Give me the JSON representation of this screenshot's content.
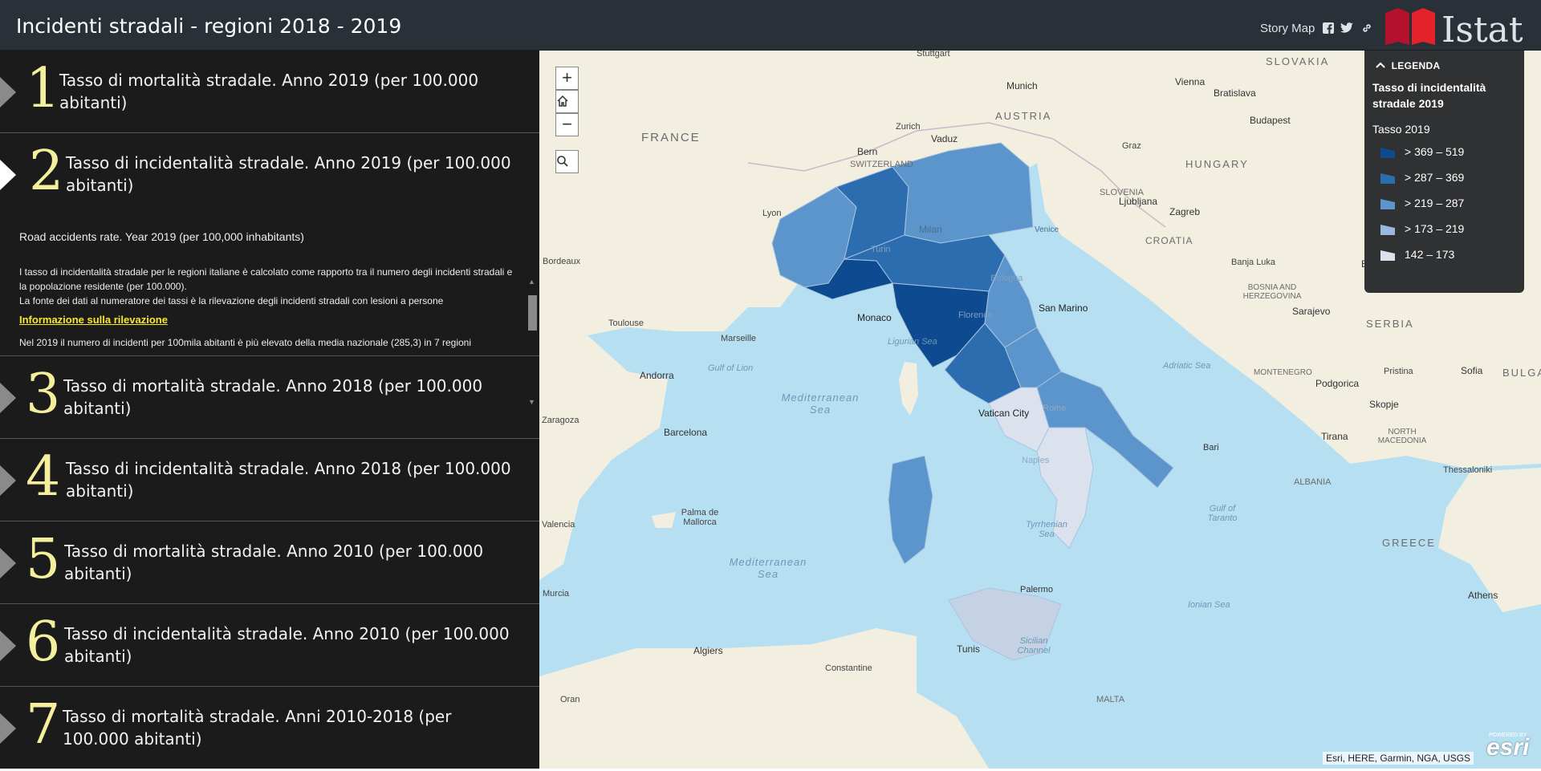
{
  "header": {
    "title": "Incidenti stradali - regioni 2018 - 2019",
    "story_map": "Story Map",
    "icons": [
      "facebook-icon",
      "twitter-icon",
      "link-icon"
    ],
    "logo_text": "Istat"
  },
  "sections": [
    {
      "num": "1",
      "title": "Tasso di mortalità stradale. Anno 2019 (per 100.000 abitanti)"
    },
    {
      "num": "2",
      "title": "Tasso di incidentalità stradale. Anno 2019 (per 100.000 abitanti)"
    },
    {
      "num": "3",
      "title": "Tasso di mortalità stradale. Anno 2018 (per 100.000 abitanti)"
    },
    {
      "num": "4",
      "title": "Tasso di incidentalità stradale. Anno 2018 (per 100.000 abitanti)"
    },
    {
      "num": "5",
      "title": "Tasso di mortalità stradale. Anno 2010 (per 100.000 abitanti)"
    },
    {
      "num": "6",
      "title": "Tasso di incidentalità stradale. Anno 2010 (per 100.000 abitanti)"
    },
    {
      "num": "7",
      "title": "Tasso di mortalità stradale. Anni 2010-2018 (per 100.000 abitanti)"
    }
  ],
  "active_section": {
    "english": "Road accidents rate. Year 2019 (per 100,000 inhabitants)",
    "desc_1": " I tasso di incidentalità stradale per le regioni italiane è calcolato come rapporto tra il numero degli incidenti stradali e la popolazione residente (per 100.000).",
    "desc_2": "La fonte dei dati al numeratore dei tassi è la rilevazione degli incidenti stradali con lesioni a persone",
    "info_link": "Informazione sulla rilevazione",
    "footer": "Nel 2019 il numero di incidenti per 100mila abitanti è più elevato della media nazionale (285,3) in 7 regioni"
  },
  "map": {
    "zoom_in": "+",
    "zoom_out": "−",
    "labels": {
      "france": "FRANCE",
      "switzerland": "SWITZERLAND",
      "austria": "AUSTRIA",
      "hungary": "HUNGARY",
      "slovenia": "SLOVENIA",
      "croatia": "CROATIA",
      "bosnia": "BOSNIA AND HERZEGOVINA",
      "serbia": "SERBIA",
      "montenegro": "MONTENEGRO",
      "albania": "ALBANIA",
      "north_macedonia": "NORTH MACEDONIA",
      "greece": "GREECE",
      "slovakia": "SLOVAKIA",
      "bulgaria": "BULGAR",
      "malta": "MALTA",
      "stuttgart": "Stuttgart",
      "munich": "Munich",
      "vienna": "Vienna",
      "bratislava": "Bratislava",
      "budapest": "Budapest",
      "zurich": "Zurich",
      "vaduz": "Vaduz",
      "bern": "Bern",
      "graz": "Graz",
      "ljubljana": "Ljubljana",
      "zagreb": "Zagreb",
      "lyon": "Lyon",
      "bordeaux": "Bordeaux",
      "milan": "Milan",
      "turin": "Turin",
      "venice": "Venice",
      "bologna": "Bologna",
      "monaco": "Monaco",
      "san_marino": "San Marino",
      "florence": "Florence",
      "toulouse": "Toulouse",
      "marseille": "Marseille",
      "andorra": "Andorra",
      "zaragoza": "Zaragoza",
      "barcelona": "Barcelona",
      "valencia": "Valencia",
      "palma": "Palma de Mallorca",
      "murcia": "Murcia",
      "algiers": "Algiers",
      "tunis": "Tunis",
      "constantine": "Constantine",
      "oran": "Oran",
      "palermo": "Palermo",
      "naples": "Naples",
      "vatican": "Vatican City",
      "rome": "Rome",
      "bari": "Bari",
      "banja_luka": "Banja Luka",
      "sarajevo": "Sarajevo",
      "belgrade": "Belgra",
      "podgorica": "Podgorica",
      "pristina": "Pristina",
      "sofia": "Sofia",
      "skopje": "Skopje",
      "tirana": "Tirana",
      "thessaloniki": "Thessaloniki",
      "athens": "Athens",
      "ligurian_sea": "Ligurian Sea",
      "gulf_of_lion": "Gulf of Lion",
      "mediterranean_sea": "Mediterranean Sea",
      "adriatic_sea": "Adriatic Sea",
      "tyrrhenian_sea": "Tyrrhenian Sea",
      "ionian_sea": "Ionian Sea",
      "sicilian_channel": "Sicilian Channel",
      "gulf_of_taranto": "Gulf of Taranto"
    }
  },
  "legend": {
    "header": "LEGENDA",
    "layer_title": "Tasso di incidentalità stradale 2019",
    "field": "Tasso 2019",
    "classes": [
      {
        "label": "> 369 – 519",
        "color": "#0d4a8f"
      },
      {
        "label": "> 287 – 369",
        "color": "#2c6db0"
      },
      {
        "label": "> 219 – 287",
        "color": "#5c95cc"
      },
      {
        "label": "> 173 – 219",
        "color": "#98b8de"
      },
      {
        "label": "142 – 173",
        "color": "#dbe2ee"
      }
    ]
  },
  "attribution": "Esri, HERE, Garmin, NGA, USGS",
  "esri_small": "POWERED BY",
  "esri": "esri"
}
